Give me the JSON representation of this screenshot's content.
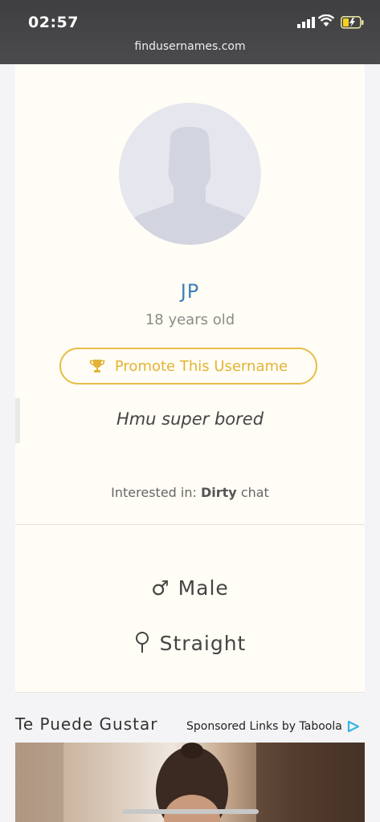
{
  "status_bar": {
    "time": "02:57",
    "url": "findusernames.com"
  },
  "profile": {
    "name": "JP",
    "age": "18 years old",
    "promote_label": "Promote This Username",
    "bio": "Hmu super bored",
    "interested_prefix": "Interested in:",
    "interested_value": "Dirty",
    "interested_suffix": "chat",
    "gender": "Male",
    "orientation": "Straight"
  },
  "recommendations": {
    "title": "Te Puede Gustar",
    "sponsored": "Sponsored Links by Taboola"
  },
  "colors": {
    "accent": "#e8bd4a",
    "name": "#3f7fb8",
    "card": "#fffdf5",
    "taboola": "#38b6e0"
  },
  "icons": [
    "signal-icon",
    "wifi-icon",
    "battery-icon",
    "avatar-placeholder-icon",
    "trophy-icon",
    "male-icon",
    "straight-icon",
    "taboola-icon"
  ]
}
